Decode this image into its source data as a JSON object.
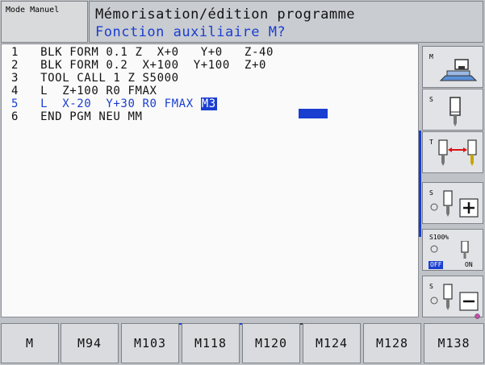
{
  "header": {
    "mode_label": "Mode Manuel",
    "title": "Mémorisation/édition programme",
    "subtitle": "Fonction auxiliaire M?"
  },
  "program": {
    "lines": [
      "1   BLK FORM 0.1 Z  X+0   Y+0   Z-40",
      "2   BLK FORM 0.2  X+100  Y+100  Z+0",
      "3   TOOL CALL 1 Z S5000",
      "4   L  Z+100 R0 FMAX",
      "5   L  X-20  Y+30 R0 FMAX ",
      "6   END PGM NEU MM"
    ],
    "active_line_index": 4,
    "active_highlight": "M3"
  },
  "side_softkeys": {
    "m_label": "M",
    "s_label": "S",
    "t_label": "T",
    "s_plus_label": "S",
    "override_pct": "S100%",
    "off_label": "OFF",
    "on_label": "ON",
    "s_minus_label": "S",
    "plus_sign": "+",
    "minus_sign": "−"
  },
  "bottom_softkeys": [
    "M",
    "M94",
    "M103",
    "M118",
    "M120",
    "M124",
    "M128",
    "M138"
  ],
  "colors": {
    "accent": "#1a3ed0",
    "background": "#bfc3c8",
    "program_bg": "#fafafa"
  },
  "icons": [
    "machine-table-icon",
    "spindle-icon",
    "tool-change-icon",
    "spindle-plus-icon",
    "spindle-override-icon",
    "spindle-minus-icon"
  ]
}
